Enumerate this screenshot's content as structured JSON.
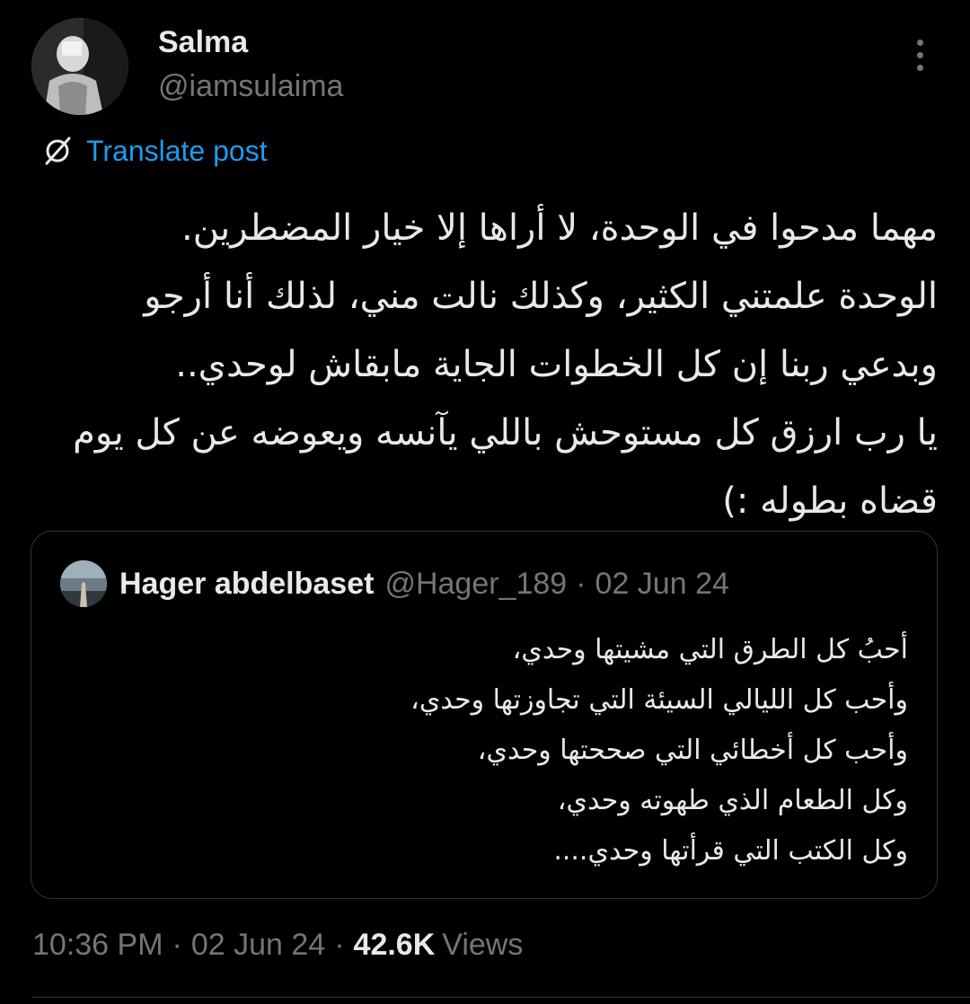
{
  "author": {
    "display_name": "Salma",
    "handle": "@iamsulaima"
  },
  "translate": {
    "label": "Translate post"
  },
  "tweet": {
    "lines": [
      "مهما مدحوا في الوحدة، لا أراها إلا خيار المضطرين.",
      "الوحدة علمتني الكثير، وكذلك نالت مني، لذلك أنا أرجو",
      "وبدعي ربنا إن كل الخطوات الجاية مابقاش لوحدي..",
      "يا رب ارزق كل مستوحش باللي يآنسه ويعوضه عن كل يوم",
      "قضاه بطوله :)"
    ]
  },
  "quote": {
    "name": "Hager abdelbaset",
    "handle": "@Hager_189",
    "separator": "·",
    "date": "02 Jun 24",
    "lines": [
      "أحبُ كل الطرق التي مشيتها وحدي،",
      "وأحب كل الليالي السيئة التي تجاوزتها وحدي،",
      "وأحب كل أخطائي التي صححتها وحدي،",
      "وكل الطعام الذي طهوته وحدي،",
      "وكل الكتب التي قرأتها وحدي...."
    ]
  },
  "meta": {
    "time": "10:36 PM",
    "separator": "·",
    "date": "02 Jun 24",
    "views_count": "42.6K",
    "views_label": "Views"
  },
  "colors": {
    "background": "#000000",
    "text_primary": "#e7e9ea",
    "text_secondary": "#71767b",
    "link": "#1d9bf0",
    "border": "#2f3336"
  },
  "icons": {
    "translate": "translate-icon",
    "more": "more-options-icon"
  }
}
